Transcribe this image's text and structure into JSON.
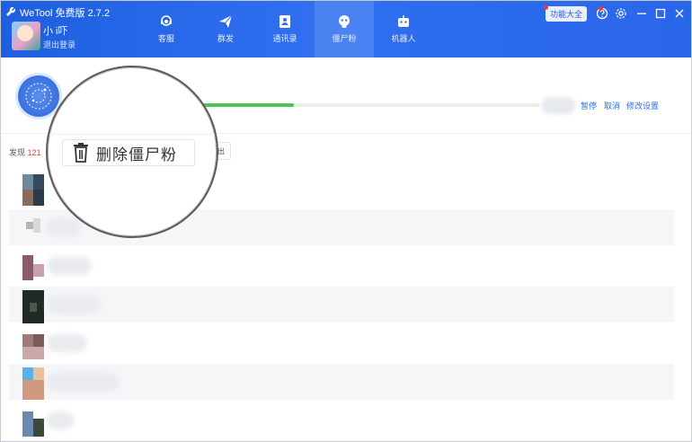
{
  "app": {
    "title": "WeTool 免费版 2.7.2"
  },
  "user": {
    "name": "小 i吓",
    "logout": "退出登录"
  },
  "nav": [
    {
      "label": "客服",
      "icon": "customer-service-icon"
    },
    {
      "label": "群发",
      "icon": "send-icon"
    },
    {
      "label": "通讯录",
      "icon": "contacts-icon"
    },
    {
      "label": "僵尸粉",
      "icon": "zombie-icon"
    },
    {
      "label": "机器人",
      "icon": "robot-icon"
    }
  ],
  "header": {
    "function_btn": "功能大全"
  },
  "progress": {
    "value": 0.27,
    "pause": "暂停",
    "cancel": "取消",
    "settings": "修改设置"
  },
  "list": {
    "found_prefix": "发现 ",
    "found_count": "121"
  },
  "magnifier": {
    "delete_label": "删除僵尸粉"
  },
  "colors": {
    "header_blue": "#2a66ea",
    "progress_green": "#4cc45a",
    "link_blue": "#2b6fe6",
    "count_red": "#e23a3a"
  }
}
